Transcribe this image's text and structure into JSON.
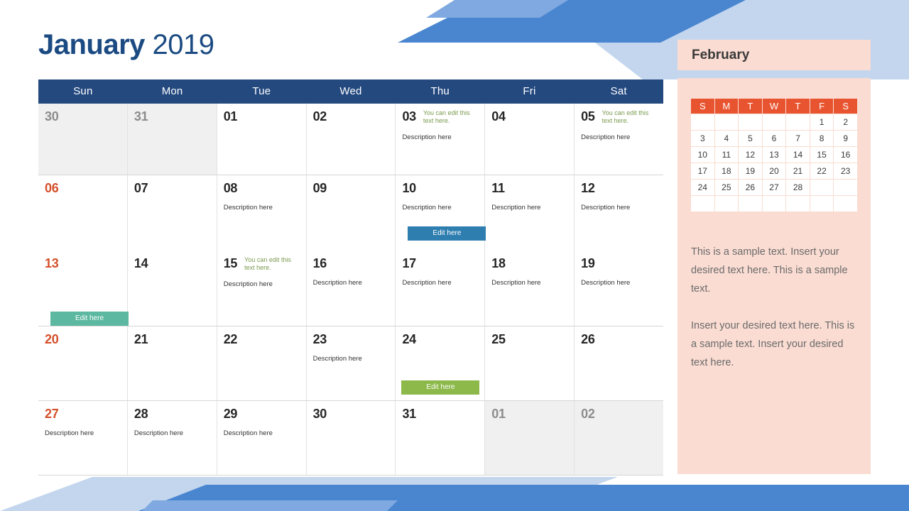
{
  "title": {
    "month": "January",
    "year": "2019"
  },
  "colors": {
    "header_navy": "#24497f",
    "title_blue": "#1b4b82",
    "sunday_orange": "#d4502a",
    "note_green": "#7a9a4e",
    "btn_blue": "#2e7eb0",
    "btn_teal": "#5cb8a0",
    "btn_olive": "#8cb94a",
    "panel_pink": "#fadcd2",
    "mini_header_orange": "#e8542f",
    "muted_cell": "#f0f0f0",
    "deco_blue_dark": "#4a86d0",
    "deco_blue_mid": "#7fa9e0",
    "deco_blue_light": "#c3d6ee"
  },
  "weekdays": [
    "Sun",
    "Mon",
    "Tue",
    "Wed",
    "Thu",
    "Fri",
    "Sat"
  ],
  "edit_button_label": "Edit here",
  "note_text": "You can edit this text here.",
  "description_text": "Description here",
  "weeks": [
    {
      "days": [
        {
          "num": "30",
          "muted": true,
          "sunday": false,
          "note": "",
          "desc": "",
          "button": null
        },
        {
          "num": "31",
          "muted": true,
          "sunday": false,
          "note": "",
          "desc": "",
          "button": null
        },
        {
          "num": "01",
          "muted": false,
          "sunday": false,
          "note": "",
          "desc": "",
          "button": null
        },
        {
          "num": "02",
          "muted": false,
          "sunday": false,
          "note": "",
          "desc": "",
          "button": null
        },
        {
          "num": "03",
          "muted": false,
          "sunday": false,
          "note": "You can edit this text here.",
          "desc": "Description here",
          "button": null
        },
        {
          "num": "04",
          "muted": false,
          "sunday": false,
          "note": "",
          "desc": "",
          "button": null
        },
        {
          "num": "05",
          "muted": false,
          "sunday": false,
          "note": "You can edit this text here.",
          "desc": "Description here",
          "button": null
        }
      ]
    },
    {
      "days": [
        {
          "num": "06",
          "muted": false,
          "sunday": true,
          "note": "",
          "desc": "",
          "button": null
        },
        {
          "num": "07",
          "muted": false,
          "sunday": false,
          "note": "",
          "desc": "",
          "button": null
        },
        {
          "num": "08",
          "muted": false,
          "sunday": false,
          "note": "",
          "desc": "Description here",
          "button": null
        },
        {
          "num": "09",
          "muted": false,
          "sunday": false,
          "note": "",
          "desc": "",
          "button": null
        },
        {
          "num": "10",
          "muted": false,
          "sunday": false,
          "note": "",
          "desc": "Description here",
          "button": {
            "label": "Edit here",
            "color": "blue"
          }
        },
        {
          "num": "11",
          "muted": false,
          "sunday": false,
          "note": "",
          "desc": "Description here",
          "button": null
        },
        {
          "num": "12",
          "muted": false,
          "sunday": false,
          "note": "",
          "desc": "Description here",
          "button": null
        }
      ]
    },
    {
      "days": [
        {
          "num": "13",
          "muted": false,
          "sunday": true,
          "note": "",
          "desc": "",
          "button": {
            "label": "Edit here",
            "color": "teal"
          }
        },
        {
          "num": "14",
          "muted": false,
          "sunday": false,
          "note": "",
          "desc": "",
          "button": null
        },
        {
          "num": "15",
          "muted": false,
          "sunday": false,
          "note": "You can edit this text here.",
          "desc": "Description here",
          "button": null
        },
        {
          "num": "16",
          "muted": false,
          "sunday": false,
          "note": "",
          "desc": "Description here",
          "button": null
        },
        {
          "num": "17",
          "muted": false,
          "sunday": false,
          "note": "",
          "desc": "Description here",
          "button": null
        },
        {
          "num": "18",
          "muted": false,
          "sunday": false,
          "note": "",
          "desc": "Description here",
          "button": null
        },
        {
          "num": "19",
          "muted": false,
          "sunday": false,
          "note": "",
          "desc": "Description here",
          "button": null
        }
      ]
    },
    {
      "days": [
        {
          "num": "20",
          "muted": false,
          "sunday": true,
          "note": "",
          "desc": "",
          "button": null
        },
        {
          "num": "21",
          "muted": false,
          "sunday": false,
          "note": "",
          "desc": "",
          "button": null
        },
        {
          "num": "22",
          "muted": false,
          "sunday": false,
          "note": "",
          "desc": "",
          "button": null
        },
        {
          "num": "23",
          "muted": false,
          "sunday": false,
          "note": "",
          "desc": "Description here",
          "button": null
        },
        {
          "num": "24",
          "muted": false,
          "sunday": false,
          "note": "",
          "desc": "",
          "button": {
            "label": "Edit here",
            "color": "olive"
          }
        },
        {
          "num": "25",
          "muted": false,
          "sunday": false,
          "note": "",
          "desc": "",
          "button": null
        },
        {
          "num": "26",
          "muted": false,
          "sunday": false,
          "note": "",
          "desc": "",
          "button": null
        }
      ]
    },
    {
      "days": [
        {
          "num": "27",
          "muted": false,
          "sunday": true,
          "note": "",
          "desc": "Description here",
          "button": null
        },
        {
          "num": "28",
          "muted": false,
          "sunday": false,
          "note": "",
          "desc": "Description here",
          "button": null
        },
        {
          "num": "29",
          "muted": false,
          "sunday": false,
          "note": "",
          "desc": "Description here",
          "button": null
        },
        {
          "num": "30",
          "muted": false,
          "sunday": false,
          "note": "",
          "desc": "",
          "button": null
        },
        {
          "num": "31",
          "muted": false,
          "sunday": false,
          "note": "",
          "desc": "",
          "button": null
        },
        {
          "num": "01",
          "muted": true,
          "sunday": false,
          "note": "",
          "desc": "",
          "button": null
        },
        {
          "num": "02",
          "muted": true,
          "sunday": false,
          "note": "",
          "desc": "",
          "button": null
        }
      ]
    }
  ],
  "side_panel": {
    "month_label": "February",
    "mini_weekdays": [
      "S",
      "M",
      "T",
      "W",
      "T",
      "F",
      "S"
    ],
    "mini_weeks": [
      [
        "",
        "",
        "",
        "",
        "",
        "1",
        "2"
      ],
      [
        "3",
        "4",
        "5",
        "6",
        "7",
        "8",
        "9"
      ],
      [
        "10",
        "11",
        "12",
        "13",
        "14",
        "15",
        "16"
      ],
      [
        "17",
        "18",
        "19",
        "20",
        "21",
        "22",
        "23"
      ],
      [
        "24",
        "25",
        "26",
        "27",
        "28",
        "",
        ""
      ],
      [
        "",
        "",
        "",
        "",
        "",
        "",
        ""
      ]
    ],
    "paragraphs": [
      "This is a sample text. Insert your desired text here. This is a sample text.",
      "Insert your desired text here. This is a sample text. Insert your desired text here."
    ]
  }
}
